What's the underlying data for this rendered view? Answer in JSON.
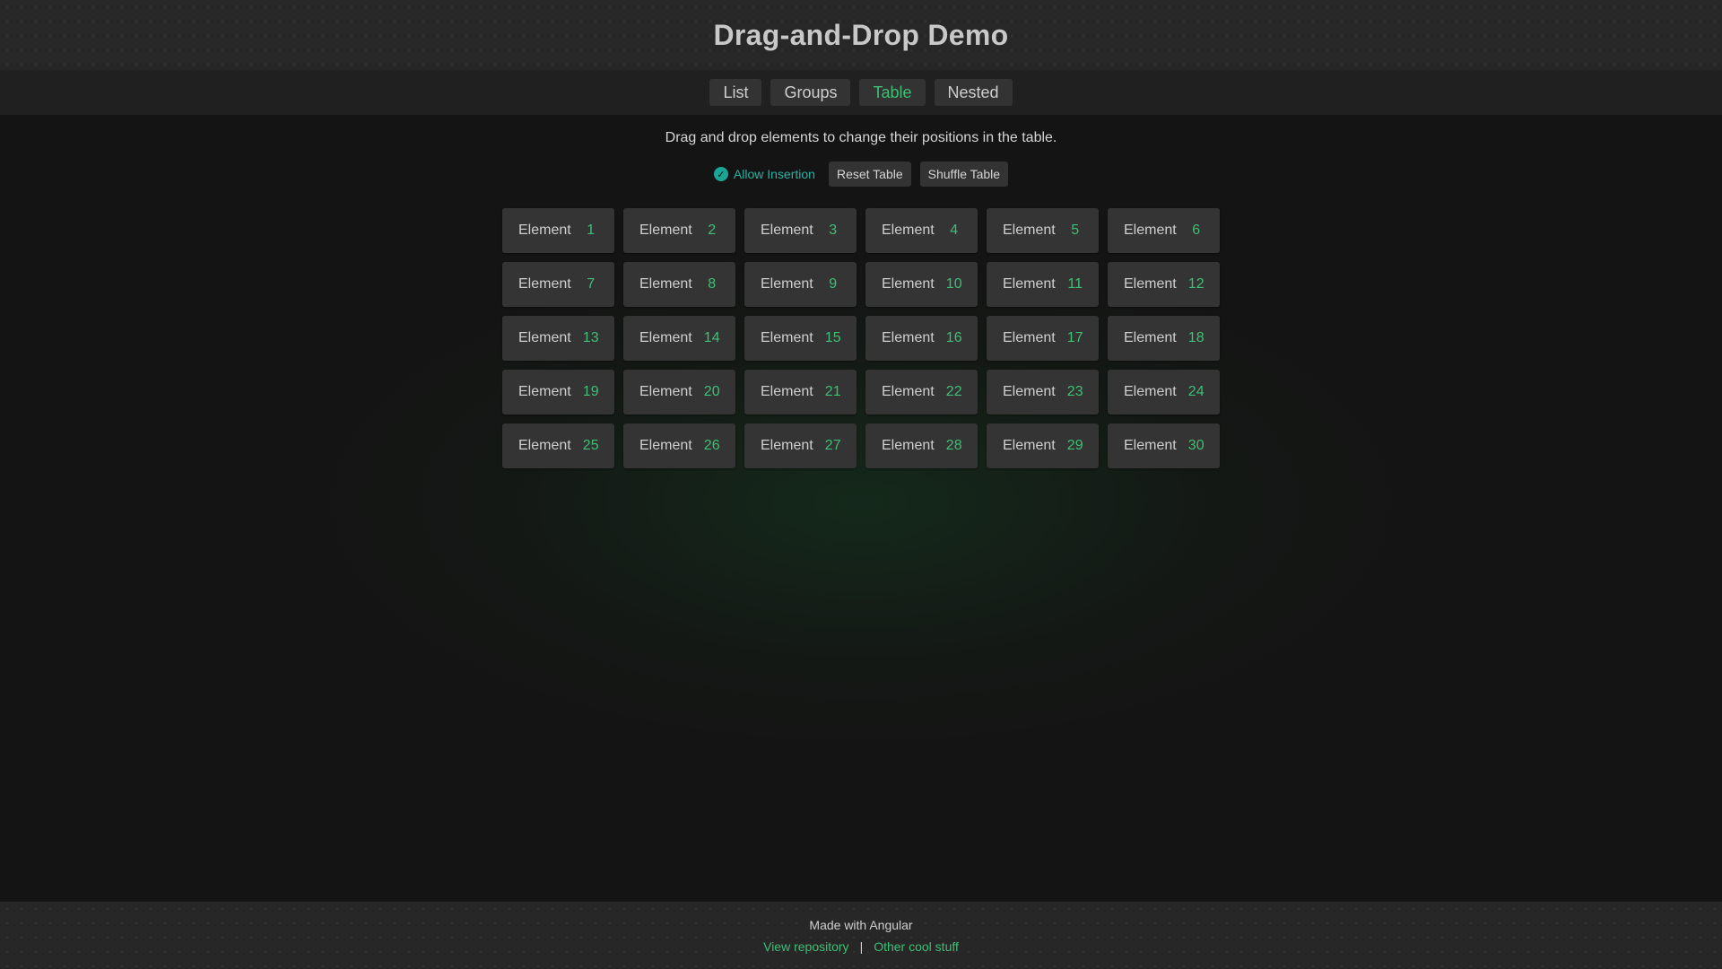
{
  "header": {
    "title": "Drag-and-Drop Demo"
  },
  "tabs": [
    {
      "label": "List",
      "active": false
    },
    {
      "label": "Groups",
      "active": false
    },
    {
      "label": "Table",
      "active": true
    },
    {
      "label": "Nested",
      "active": false
    }
  ],
  "description": "Drag and drop elements to change their positions in the table.",
  "controls": {
    "allow_insertion": {
      "label": "Allow Insertion",
      "checked": true,
      "check_glyph": "✓"
    },
    "reset_label": "Reset Table",
    "shuffle_label": "Shuffle Table"
  },
  "table": {
    "cells": [
      {
        "word": "Element",
        "num": "1"
      },
      {
        "word": "Element",
        "num": "2"
      },
      {
        "word": "Element",
        "num": "3"
      },
      {
        "word": "Element",
        "num": "4"
      },
      {
        "word": "Element",
        "num": "5"
      },
      {
        "word": "Element",
        "num": "6"
      },
      {
        "word": "Element",
        "num": "7"
      },
      {
        "word": "Element",
        "num": "8"
      },
      {
        "word": "Element",
        "num": "9"
      },
      {
        "word": "Element",
        "num": "10"
      },
      {
        "word": "Element",
        "num": "11"
      },
      {
        "word": "Element",
        "num": "12"
      },
      {
        "word": "Element",
        "num": "13"
      },
      {
        "word": "Element",
        "num": "14"
      },
      {
        "word": "Element",
        "num": "15"
      },
      {
        "word": "Element",
        "num": "16"
      },
      {
        "word": "Element",
        "num": "17"
      },
      {
        "word": "Element",
        "num": "18"
      },
      {
        "word": "Element",
        "num": "19"
      },
      {
        "word": "Element",
        "num": "20"
      },
      {
        "word": "Element",
        "num": "21"
      },
      {
        "word": "Element",
        "num": "22"
      },
      {
        "word": "Element",
        "num": "23"
      },
      {
        "word": "Element",
        "num": "24"
      },
      {
        "word": "Element",
        "num": "25"
      },
      {
        "word": "Element",
        "num": "26"
      },
      {
        "word": "Element",
        "num": "27"
      },
      {
        "word": "Element",
        "num": "28"
      },
      {
        "word": "Element",
        "num": "29"
      },
      {
        "word": "Element",
        "num": "30"
      }
    ]
  },
  "footer": {
    "made_with": "Made with Angular",
    "repo_link": "View repository",
    "separator": "|",
    "other_link": "Other cool stuff"
  },
  "colors": {
    "accent_green": "#3fbf74",
    "accent_teal": "#1aa596",
    "background": "#141414",
    "panel": "#272727",
    "button": "#333333"
  }
}
